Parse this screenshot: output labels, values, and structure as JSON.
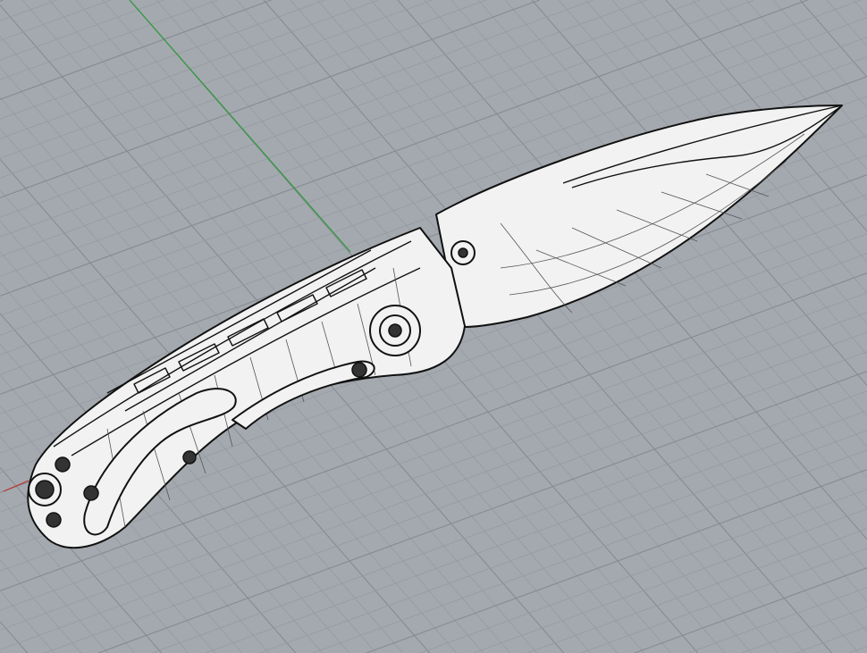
{
  "viewport": {
    "view": "perspective",
    "colors": {
      "background": "#a4a9af",
      "grid_minor": "#959aa0",
      "grid_major": "#868b91",
      "axis_x": "#c0302a",
      "axis_y": "#2e9a3a",
      "model_fill": "#f2f2f2",
      "model_stroke": "#111111",
      "model_wire": "#555555"
    }
  },
  "model": {
    "name": "folding-knife",
    "parts": [
      "blade",
      "handle",
      "pocket-clip",
      "pivot-screw",
      "lanyard-hole"
    ]
  }
}
